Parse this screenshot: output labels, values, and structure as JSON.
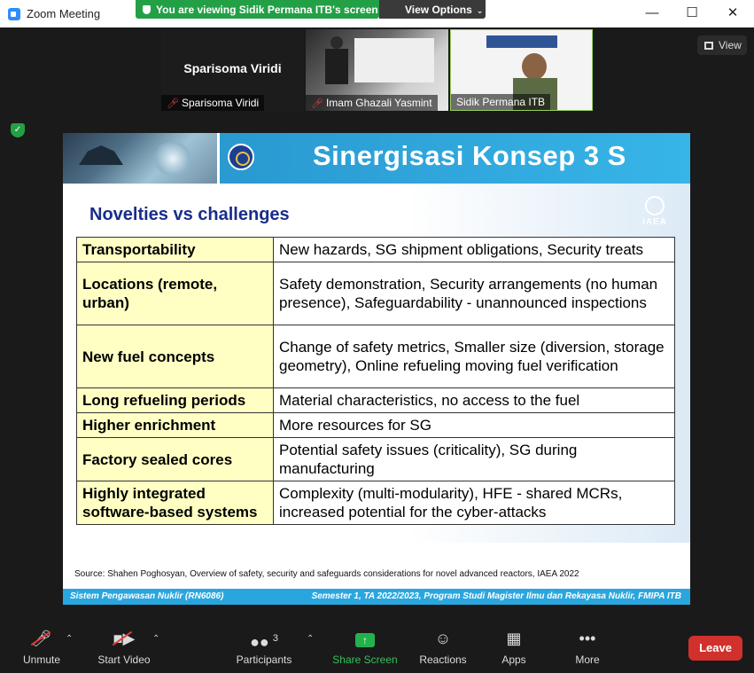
{
  "window": {
    "title": "Zoom Meeting"
  },
  "share_banner": {
    "text": "You are viewing Sidik Permana ITB's screen"
  },
  "view_options": {
    "label": "View Options"
  },
  "view_button": {
    "label": "View"
  },
  "participants": [
    {
      "display_name": "Sparisoma Viridi",
      "label": "Sparisoma Viridi",
      "muted": true,
      "video": false
    },
    {
      "label": "Imam Ghazali Yasmint",
      "muted": true,
      "video": true
    },
    {
      "label": "Sidik Permana ITB",
      "muted": false,
      "video": true,
      "active_speaker": true
    }
  ],
  "slide": {
    "title": "Sinergisasi Konsep 3 S",
    "subtitle": "Novelties vs challenges",
    "iaea_label": "IAEA",
    "rows": [
      {
        "challenge": "Transportability",
        "detail": "New hazards, SG shipment obligations, Security treats"
      },
      {
        "challenge": "Locations (remote, urban)",
        "detail": "Safety demonstration, Security arrangements (no human presence), Safeguardability - unannounced inspections"
      },
      {
        "challenge": "New fuel concepts",
        "detail": "Change of safety metrics, Smaller size (diversion, storage geometry), Online refueling moving fuel verification"
      },
      {
        "challenge": "Long refueling periods",
        "detail": "Material characteristics, no access to the fuel"
      },
      {
        "challenge": "Higher enrichment",
        "detail": "More resources for SG"
      },
      {
        "challenge": "Factory sealed cores",
        "detail": "Potential safety issues (criticality), SG during manufacturing"
      },
      {
        "challenge": "Highly integrated software-based systems",
        "detail": "Complexity (multi-modularity),  HFE - shared MCRs, increased potential for the cyber-attacks"
      }
    ],
    "source": "Source: Shahen Poghosyan, Overview of safety, security and safeguards considerations for novel advanced reactors, IAEA 2022",
    "footer_left": "Sistem Pengawasan Nuklir (RN6086)",
    "footer_right": "Semester 1, TA 2022/2023, Program Studi Magister Ilmu dan Rekayasa Nuklir, FMIPA ITB"
  },
  "toolbar": {
    "unmute": "Unmute",
    "start_video": "Start Video",
    "participants": "Participants",
    "participants_count": "3",
    "share_screen": "Share Screen",
    "reactions": "Reactions",
    "apps": "Apps",
    "more": "More",
    "leave": "Leave"
  },
  "colors": {
    "share_green": "#23a045",
    "leave_red": "#d0312d",
    "slide_header_blue": "#2a9bd2",
    "table_challenge_bg": "#ffffc4",
    "subtitle_navy": "#1a2d8a"
  }
}
